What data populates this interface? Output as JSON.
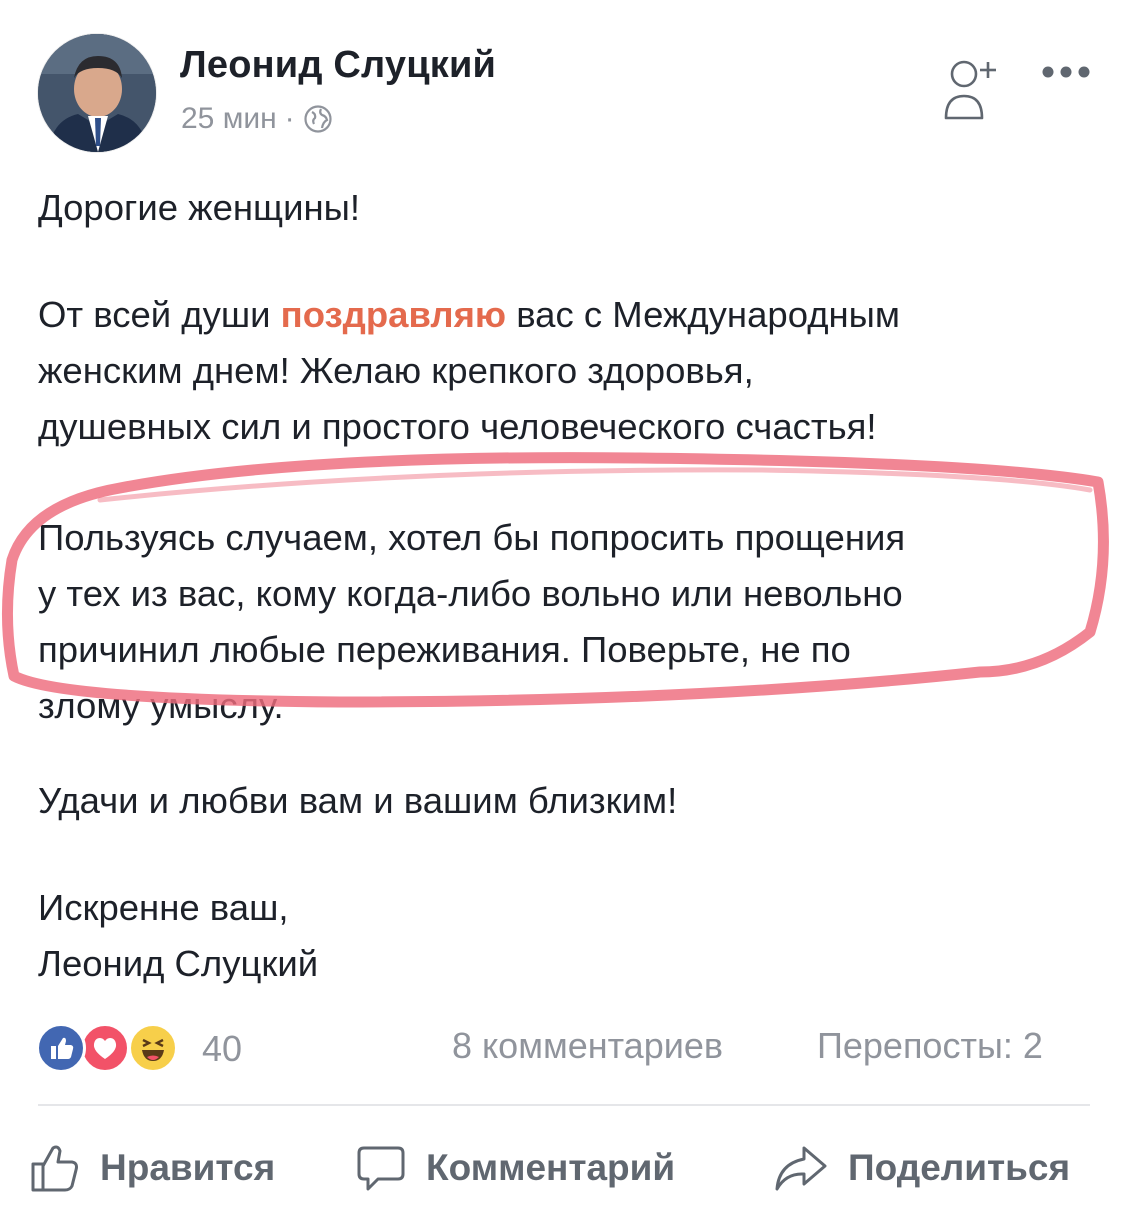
{
  "post": {
    "author": "Леонид Слуцкий",
    "time": "25 мин",
    "separator": "·",
    "privacy_icon": "globe-icon"
  },
  "body": {
    "greeting": "Дорогие женщины!",
    "congrats_prefix": "От всей души ",
    "congrats_highlight": "поздравляю",
    "congrats_suffix": " вас с Международным",
    "congrats_line2": "женским днем! Желаю крепкого здоровья,",
    "congrats_line3": "душевных сил и простого человеческого счастья!",
    "apology_line1": "Пользуясь случаем, хотел бы попросить прощения",
    "apology_line2": "у тех из вас, кому когда-либо вольно или невольно",
    "apology_line3": "причинил любые переживания. Поверьте, не по",
    "apology_line4": "злому умыслу.",
    "wishes": "Удачи и любви вам и вашим близким!",
    "sign_line1": "Искренне ваш,",
    "sign_line2": "Леонид Слуцкий"
  },
  "stats": {
    "reactions_count": "40",
    "comments": "8 комментариев",
    "shares": "Перепосты: 2",
    "reaction_types": [
      "like",
      "love",
      "haha"
    ]
  },
  "actions": {
    "like": "Нравится",
    "comment": "Комментарий",
    "share": "Поделиться"
  },
  "colors": {
    "text": "#1d2129",
    "meta": "#90949c",
    "highlight": "#e46a4d",
    "annotation": "#ee6b7d",
    "like_blue": "#4267b2",
    "love_red": "#f25268",
    "haha_yellow": "#f7cf4a"
  }
}
